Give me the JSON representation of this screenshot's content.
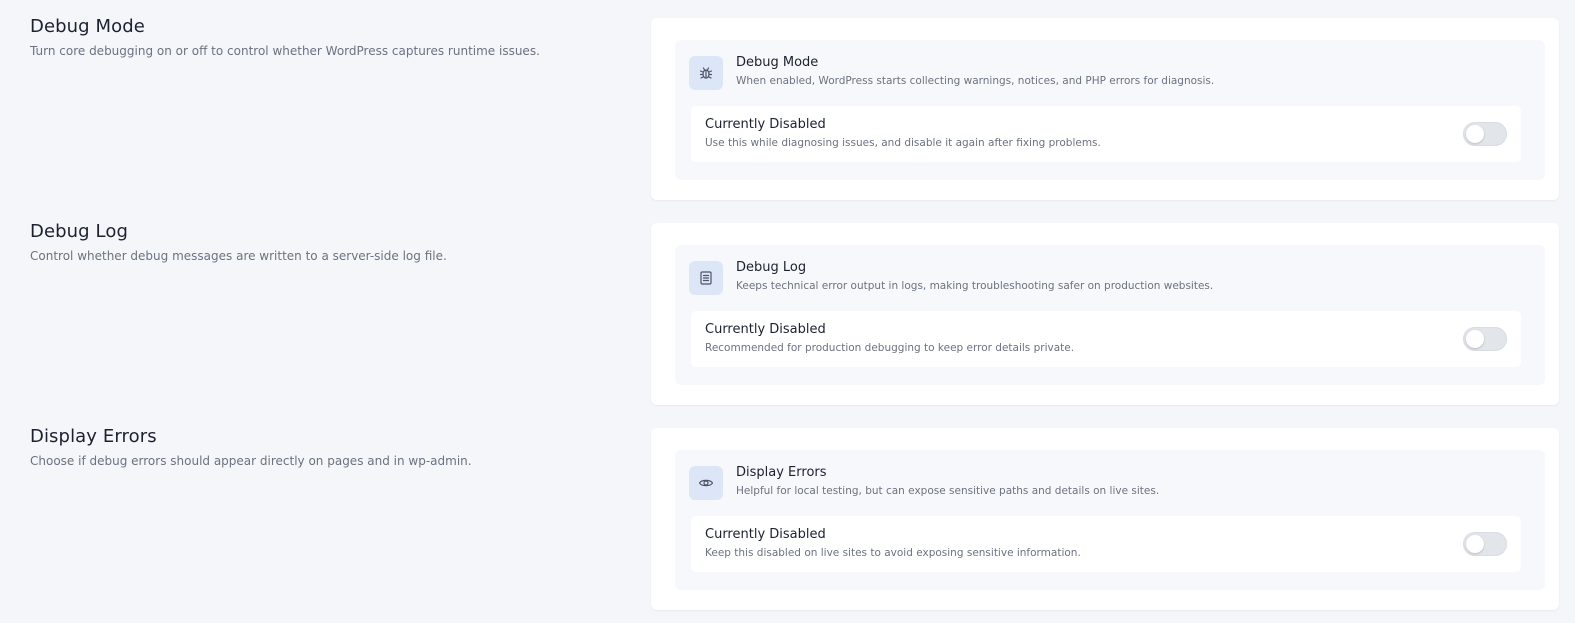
{
  "sections": [
    {
      "title": "Debug Mode",
      "description": "Turn core debugging on or off to control whether WordPress captures runtime issues.",
      "feature_title": "Debug Mode",
      "feature_description": "When enabled, WordPress starts collecting warnings, notices, and PHP errors for diagnosis.",
      "feature_icon": "bug-icon",
      "status_title": "Currently Disabled",
      "status_description": "Use this while diagnosing issues, and disable it again after fixing problems.",
      "toggle_on": false
    },
    {
      "title": "Debug Log",
      "description": "Control whether debug messages are written to a server-side log file.",
      "feature_title": "Debug Log",
      "feature_description": "Keeps technical error output in logs, making troubleshooting safer on production websites.",
      "feature_icon": "log-file-icon",
      "status_title": "Currently Disabled",
      "status_description": "Recommended for production debugging to keep error details private.",
      "toggle_on": false
    },
    {
      "title": "Display Errors",
      "description": "Choose if debug errors should appear directly on pages and in wp-admin.",
      "feature_title": "Display Errors",
      "feature_description": "Helpful for local testing, but can expose sensitive paths and details on live sites.",
      "feature_icon": "eye-icon",
      "status_title": "Currently Disabled",
      "status_description": "Keep this disabled on live sites to avoid exposing sensitive information.",
      "toggle_on": false
    }
  ],
  "colors": {
    "page_background": "#f4f6fa",
    "card_background": "#ffffff",
    "icon_tile": "#dde6f7",
    "icon_stroke": "#4a5568",
    "toggle_off": "#e2e5ea"
  }
}
